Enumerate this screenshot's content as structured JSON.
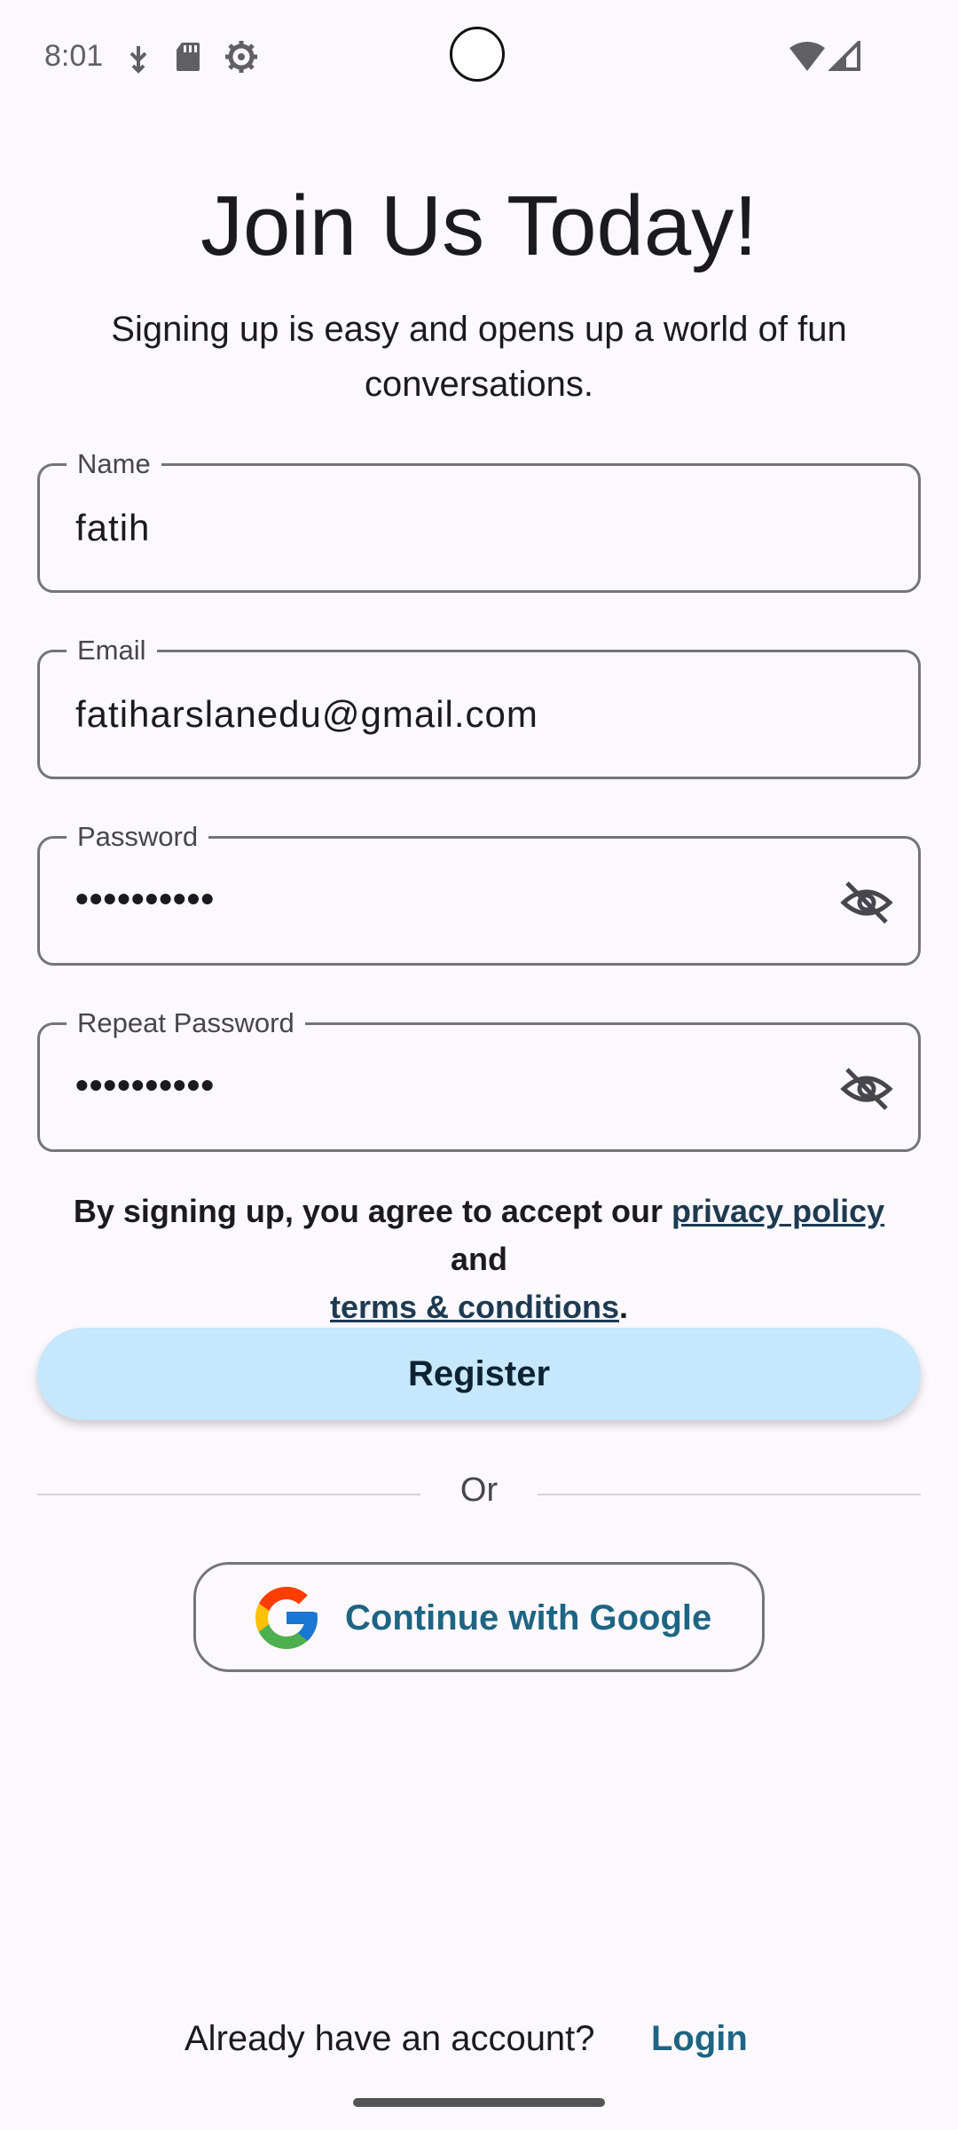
{
  "status_bar": {
    "time": "8:01",
    "icons": [
      "usb-debug-icon",
      "sd-card-icon",
      "settings-gear-icon",
      "wifi-icon",
      "cellular-signal-icon"
    ]
  },
  "header": {
    "title": "Join Us Today!",
    "subtitle": "Signing up is easy and opens up a world of fun conversations."
  },
  "form": {
    "name": {
      "label": "Name",
      "value": "fatih"
    },
    "email": {
      "label": "Email",
      "value": "fatiharslanedu@gmail.com"
    },
    "password": {
      "label": "Password",
      "value": "••••••••••"
    },
    "repeat_password": {
      "label": "Repeat Password",
      "value": "••••••••••"
    }
  },
  "terms": {
    "prefix": "By signing up, you agree to accept our",
    "privacy_link": "privacy policy",
    "middle": "and",
    "terms_link": "terms & conditions",
    "suffix": "."
  },
  "actions": {
    "register_label": "Register",
    "or_label": "Or",
    "google_label": "Continue with Google"
  },
  "footer": {
    "prompt": "Already have an account?",
    "login_label": "Login"
  },
  "colors": {
    "background": "#fbf9fd",
    "primary_container": "#c6e7fc",
    "link": "#1e6483",
    "outline": "#74747a"
  }
}
